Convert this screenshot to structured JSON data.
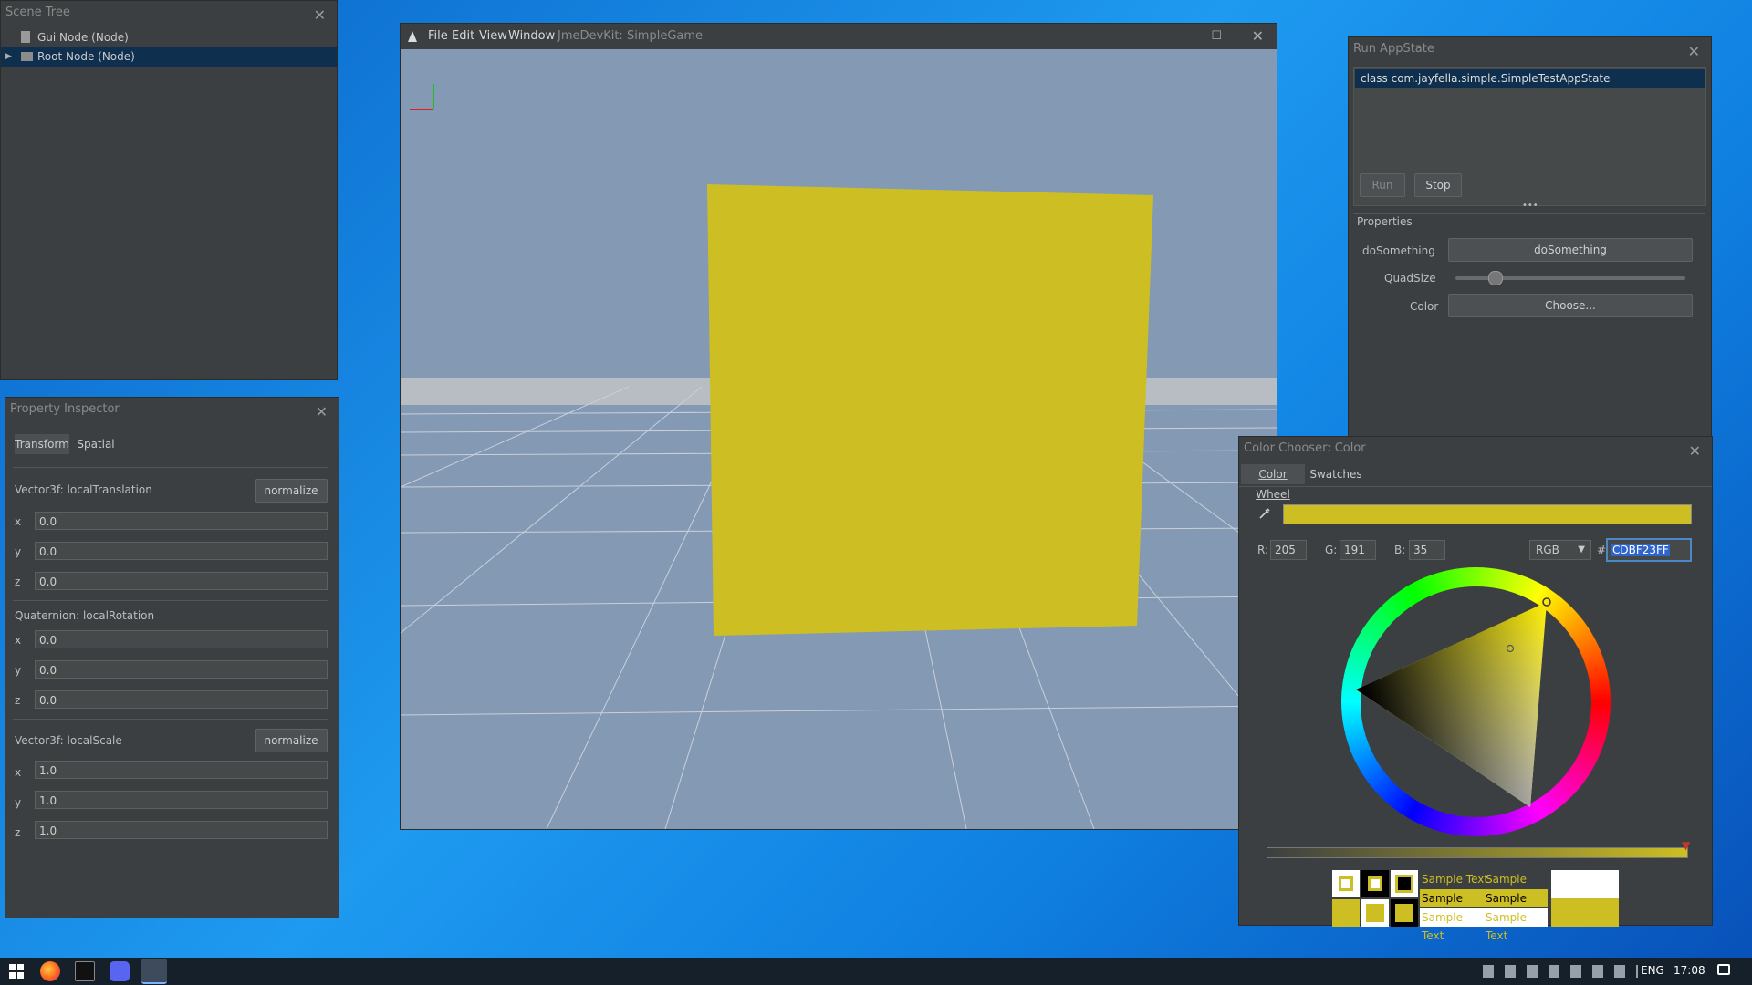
{
  "scene_tree": {
    "title": "Scene Tree",
    "items": [
      {
        "label": "Gui Node (Node)"
      },
      {
        "label": "Root Node (Node)"
      }
    ]
  },
  "inspector": {
    "title": "Property Inspector",
    "tabs": [
      "Transform",
      "Spatial"
    ],
    "translation": {
      "label": "Vector3f: localTranslation",
      "button": "normalize",
      "x": "0.0",
      "y": "0.0",
      "z": "0.0"
    },
    "rotation": {
      "label": "Quaternion: localRotation",
      "x": "0.0",
      "y": "0.0",
      "z": "0.0"
    },
    "scale": {
      "label": "Vector3f: localScale",
      "button": "normalize",
      "x": "1.0",
      "y": "1.0",
      "z": "1.0"
    },
    "axis": {
      "x": "x",
      "y": "y",
      "z": "z"
    }
  },
  "game_window": {
    "menu": [
      "File",
      "Edit",
      "View",
      "Window"
    ],
    "title": "JmeDevKit: SimpleGame",
    "quad_color": "#cdbf23",
    "sky_color": "#8499b3"
  },
  "appstate": {
    "title": "Run AppState",
    "selected": "class com.jayfella.simple.SimpleTestAppState",
    "run": "Run",
    "stop": "Stop",
    "properties_title": "Properties",
    "do_label": "doSomething",
    "do_button": "doSomething",
    "quad_label": "QuadSize",
    "quad_value": 0.17,
    "color_label": "Color",
    "color_button": "Choose..."
  },
  "chooser": {
    "title": "Color Chooser: Color",
    "tabs": [
      "Color Wheel",
      "Swatches"
    ],
    "preview_color": "#cdbf23",
    "r_label": "R:",
    "r": "205",
    "g_label": "G:",
    "g": "191",
    "b_label": "B:",
    "b": "35",
    "mode": "RGB",
    "hash": "#",
    "hex": "CDBF23FF",
    "sample": "Sample Text"
  },
  "taskbar": {
    "lang": "ENG",
    "time": "17:08"
  }
}
